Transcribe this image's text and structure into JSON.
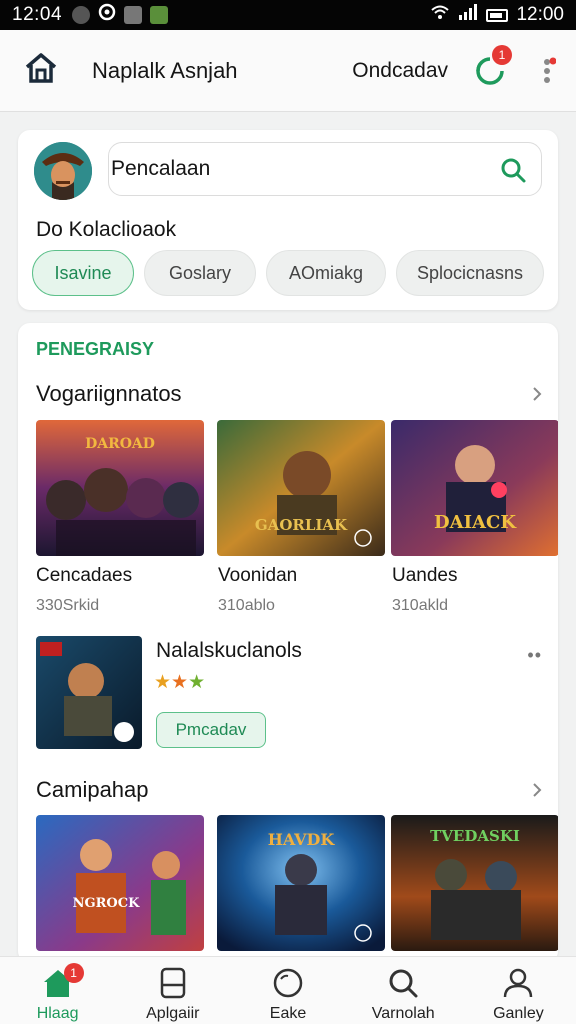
{
  "status_bar": {
    "time": "12:04",
    "clock_right": "12:00"
  },
  "header": {
    "title": "Naplalk Asnjah",
    "subtitle": "Ondcadav",
    "notification_count": "1"
  },
  "search": {
    "placeholder": "Pencalaan",
    "label": "Do Kolaclioaok"
  },
  "chips": [
    "Isavine",
    "Goslary",
    "AOmiakg",
    "Splocicnasns"
  ],
  "content": {
    "section_tag": "PENEGRAISY",
    "row1_title": "Vogariignnatos",
    "row1_items": [
      {
        "name": "Cencadaes",
        "meta": "330Srkid"
      },
      {
        "name": "Voonidan",
        "meta": "310ablo"
      },
      {
        "name": "Uandes",
        "meta": "310akld"
      }
    ],
    "feature": {
      "name": "Nalalskuclanols",
      "button": "Pmcadav"
    },
    "row2_title": "Camipahap",
    "tile_texts": [
      "DAROAD",
      "GAORLIAK",
      "DAIACK",
      "NGROCK",
      "HAVDK",
      "TVEDASKI"
    ]
  },
  "bottom_nav": {
    "items": [
      {
        "label": "Hlaag",
        "icon": "home-icon"
      },
      {
        "label": "Aplgaiir",
        "icon": "tablet-icon"
      },
      {
        "label": "Eake",
        "icon": "circle-icon"
      },
      {
        "label": "Varnolah",
        "icon": "search-icon"
      },
      {
        "label": "Ganley",
        "icon": "profile-icon"
      }
    ],
    "badge": "1"
  },
  "colors": {
    "accent": "#1e9a5c",
    "badge": "#e53935",
    "chip_active_bg": "#e6f5ec"
  }
}
